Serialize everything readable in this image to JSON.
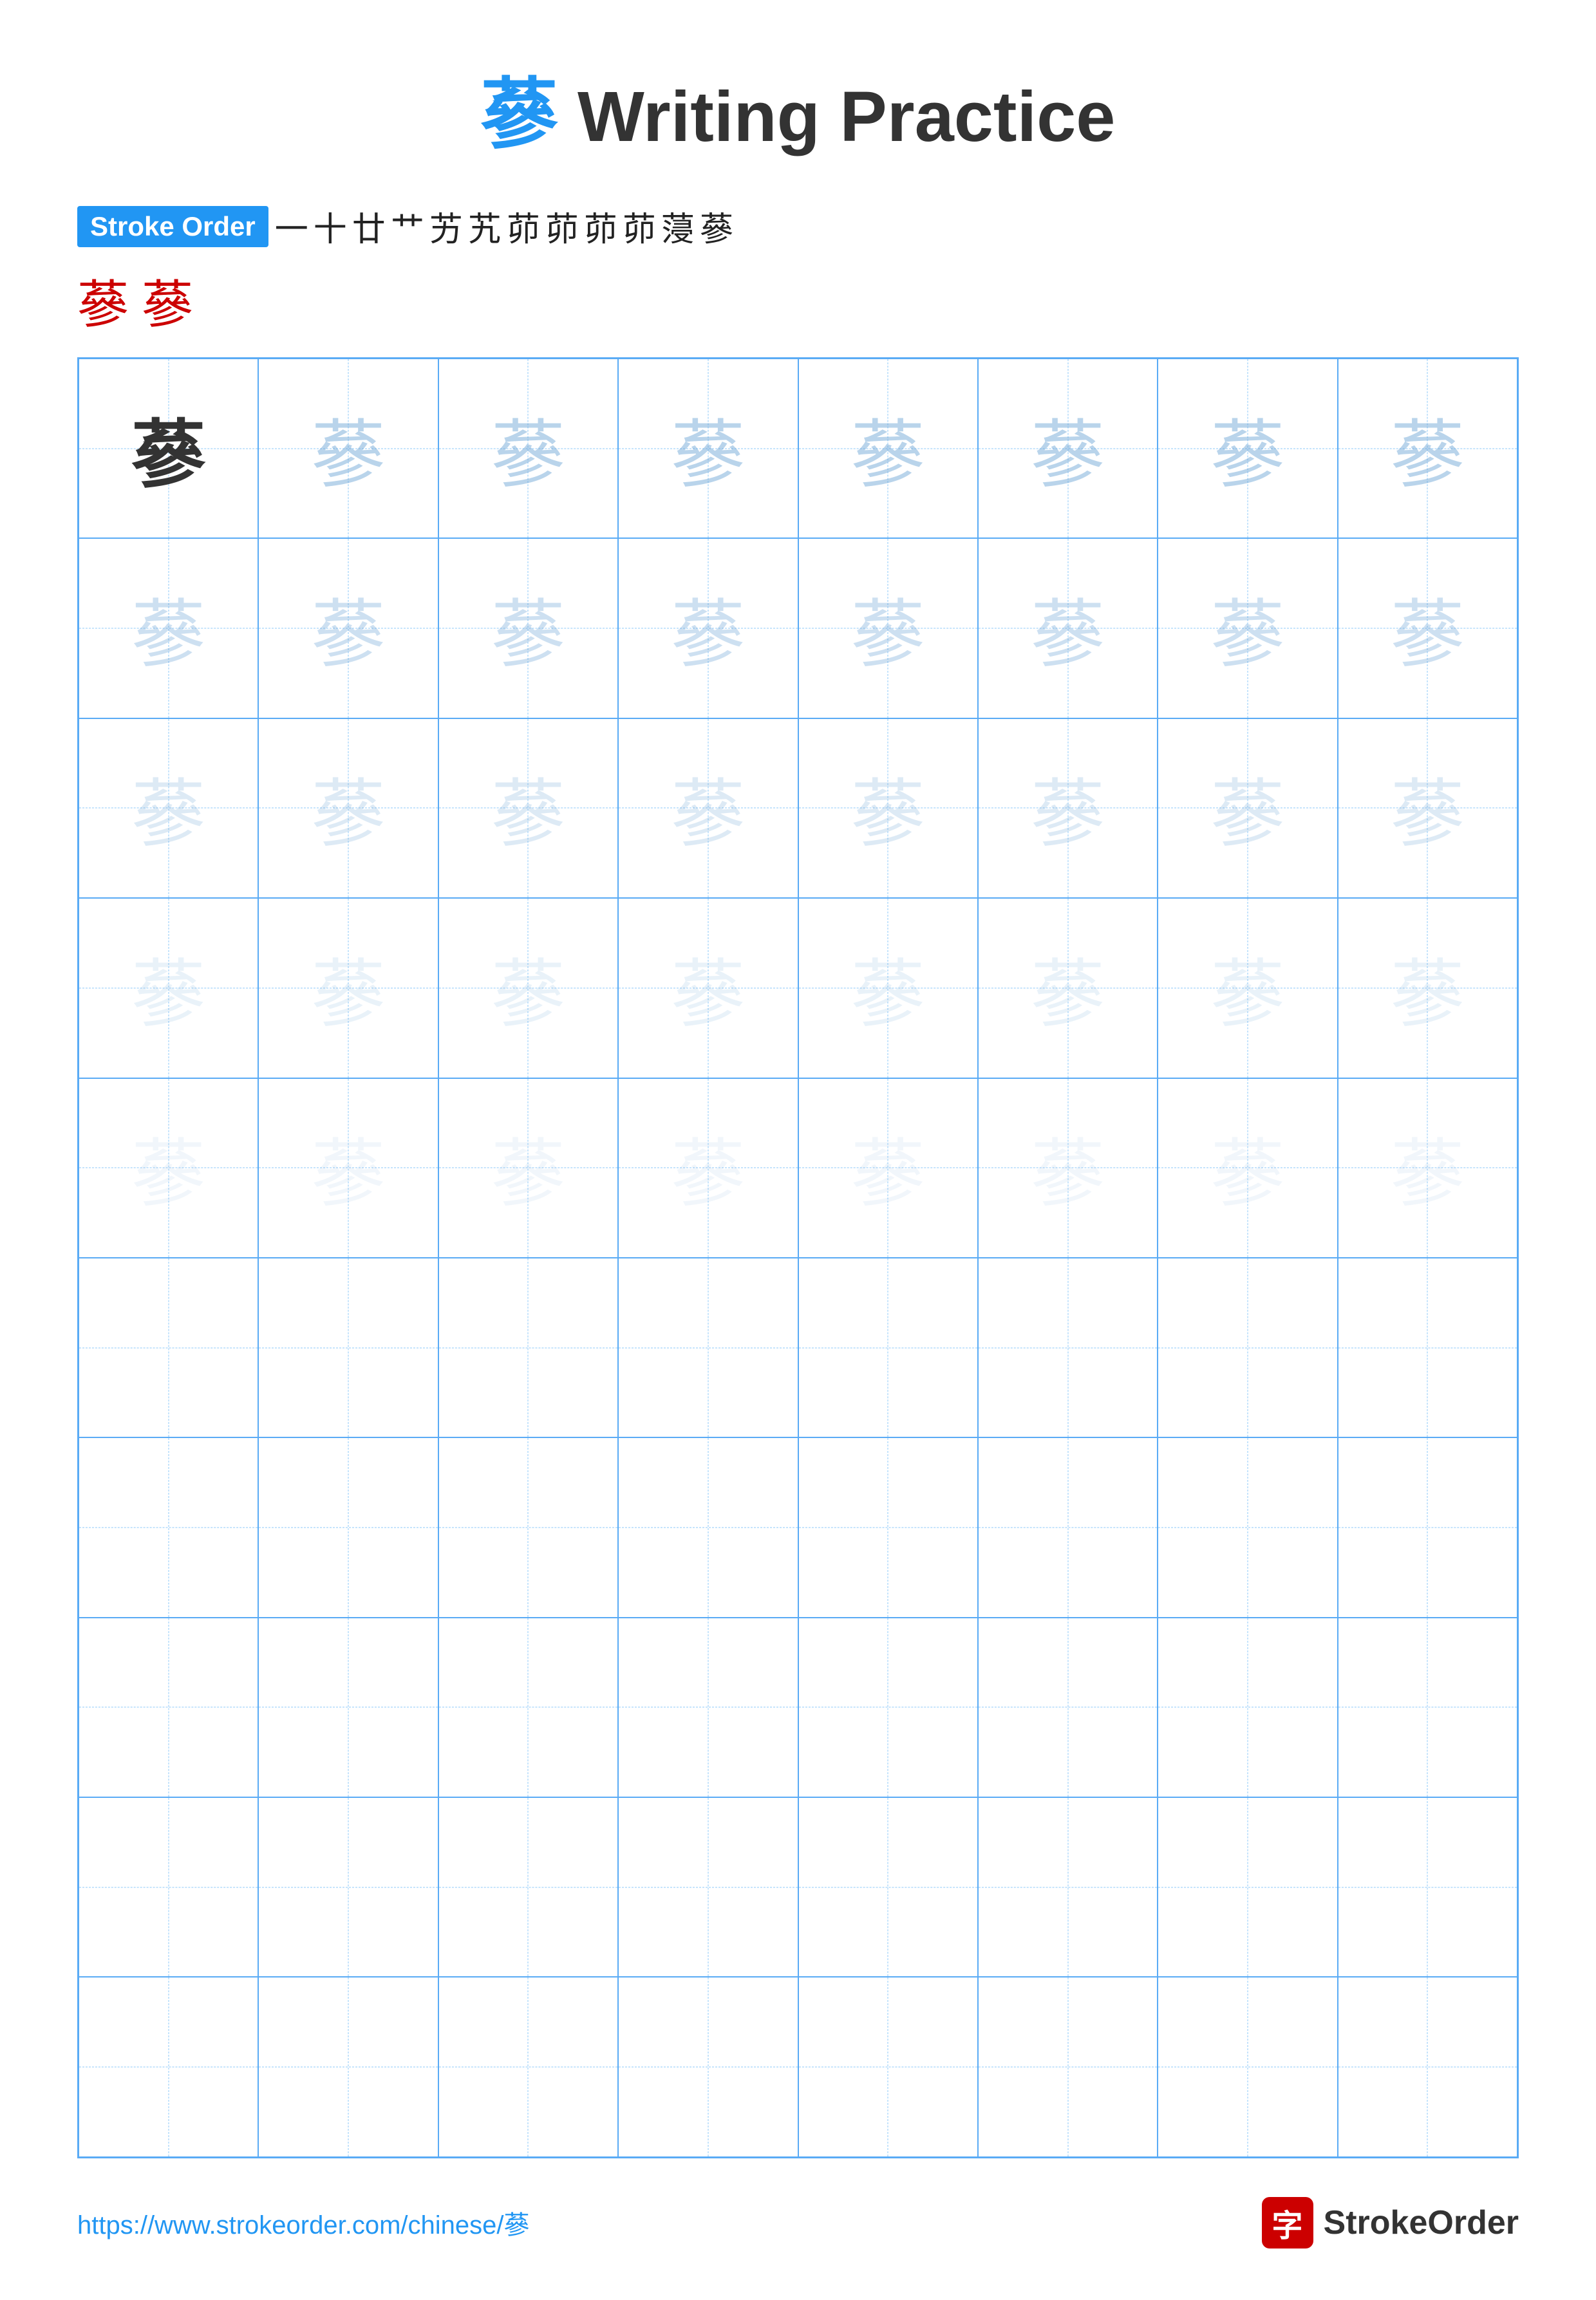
{
  "title": {
    "char": "蔘",
    "text": " Writing Practice"
  },
  "strokeOrder": {
    "badge": "Stroke Order",
    "strokes": [
      "一",
      "十",
      "廿",
      "艹",
      "艹",
      "艹",
      "艼",
      "艼",
      "艼",
      "艼",
      "蔘",
      "蔘"
    ],
    "line2chars": [
      "蔘",
      "蔘"
    ]
  },
  "grid": {
    "rows": 10,
    "cols": 8,
    "char": "蔘"
  },
  "footer": {
    "url": "https://www.strokeorder.com/chinese/蔘",
    "logoChar": "字",
    "logoText": "StrokeOrder"
  }
}
